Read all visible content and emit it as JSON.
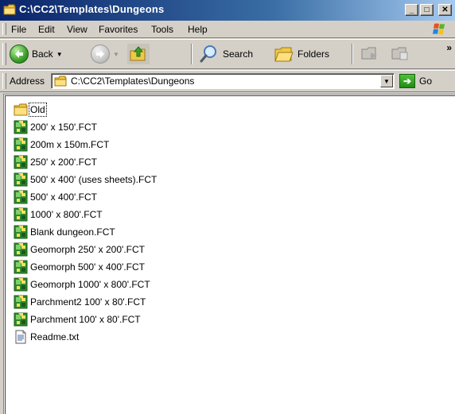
{
  "window": {
    "title": "C:\\CC2\\Templates\\Dungeons"
  },
  "caption_buttons": {
    "minimize": "_",
    "maximize": "□",
    "close": "✕"
  },
  "menu": {
    "items": [
      "File",
      "Edit",
      "View",
      "Favorites",
      "Tools",
      "Help"
    ]
  },
  "toolbar": {
    "back_label": "Back",
    "search_label": "Search",
    "folders_label": "Folders",
    "more": "»"
  },
  "address": {
    "label": "Address",
    "value": "C:\\CC2\\Templates\\Dungeons",
    "go_label": "Go"
  },
  "files": [
    {
      "name": "Old",
      "type": "folder"
    },
    {
      "name": "200' x 150'.FCT",
      "type": "fct"
    },
    {
      "name": "200m x 150m.FCT",
      "type": "fct"
    },
    {
      "name": "250' x 200'.FCT",
      "type": "fct"
    },
    {
      "name": "500' x 400' (uses sheets).FCT",
      "type": "fct"
    },
    {
      "name": "500' x 400'.FCT",
      "type": "fct"
    },
    {
      "name": "1000' x 800'.FCT",
      "type": "fct"
    },
    {
      "name": "Blank dungeon.FCT",
      "type": "fct"
    },
    {
      "name": "Geomorph 250' x 200'.FCT",
      "type": "fct"
    },
    {
      "name": "Geomorph 500' x 400'.FCT",
      "type": "fct"
    },
    {
      "name": "Geomorph 1000' x 800'.FCT",
      "type": "fct"
    },
    {
      "name": "Parchment2 100' x 80'.FCT",
      "type": "fct"
    },
    {
      "name": "Parchment 100' x 80'.FCT",
      "type": "fct"
    },
    {
      "name": "Readme.txt",
      "type": "txt"
    }
  ],
  "colors": {
    "titlebar_start": "#0a246a",
    "titlebar_end": "#a6caf0",
    "face": "#d4d0c8"
  }
}
